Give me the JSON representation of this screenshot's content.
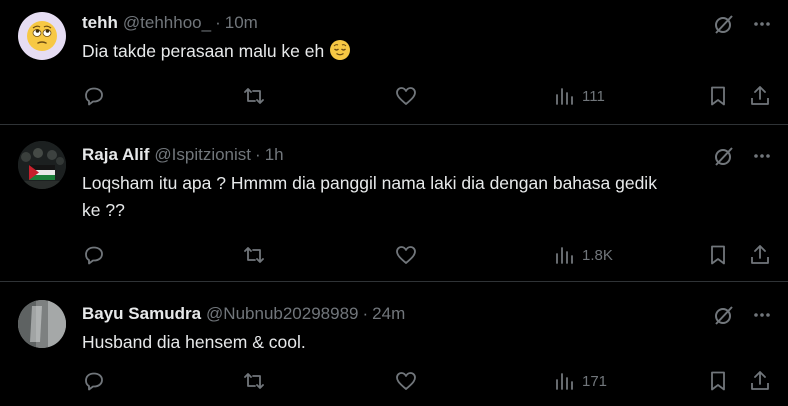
{
  "tweets": [
    {
      "name": "tehh",
      "handle": "@tehhhoo_",
      "separator": "·",
      "time": "10m",
      "text": "Dia takde perasaan malu ke eh",
      "emoji": "relieved-face",
      "views": "111",
      "avatar": "rolling-eyes-emoji"
    },
    {
      "name": "Raja Alif",
      "handle": "@Ispitzionist",
      "separator": "·",
      "time": "1h",
      "text_line1": "Loqsham itu apa ? Hmmm dia panggil nama laki dia dengan bahasa gedik",
      "text_line2": "ke ??",
      "views": "1.8K",
      "avatar": "flag-crowd-photo"
    },
    {
      "name": "Bayu Samudra",
      "handle": "@Nubnub20298989",
      "separator": "·",
      "time": "24m",
      "text": "Husband dia hensem & cool.",
      "views": "171",
      "avatar": "grey-photo"
    }
  ],
  "colors": {
    "background": "#000000",
    "text": "#e7e9ea",
    "muted": "#71767b",
    "divider": "#2f3336"
  }
}
